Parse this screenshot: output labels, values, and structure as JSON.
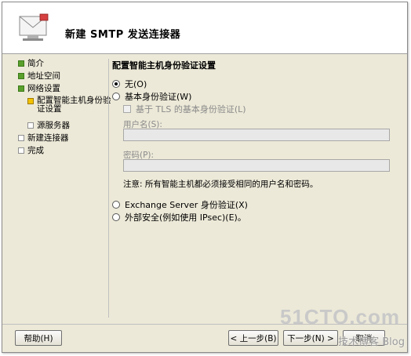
{
  "header": {
    "title": "新建 SMTP 发送连接器",
    "icon": "mail-server-icon"
  },
  "nav": {
    "items": [
      {
        "label": "简介",
        "status": "done"
      },
      {
        "label": "地址空间",
        "status": "done"
      },
      {
        "label": "网络设置",
        "status": "done"
      },
      {
        "label": "配置智能主机身份验证设置",
        "status": "current"
      },
      {
        "label": "源服务器",
        "status": "todo"
      },
      {
        "label": "新建连接器",
        "status": "todo"
      },
      {
        "label": "完成",
        "status": "todo"
      }
    ]
  },
  "content": {
    "section_title": "配置智能主机身份验证设置",
    "options": [
      {
        "label": "无(O)",
        "checked": true
      },
      {
        "label": "基本身份验证(W)",
        "checked": false
      },
      {
        "label": "Exchange Server 身份验证(X)",
        "checked": false
      },
      {
        "label": "外部安全(例如使用 IPsec)(E)。",
        "checked": false
      }
    ],
    "tls_checkbox": "基于 TLS 的基本身份验证(L)",
    "username_label": "用户名(S):",
    "username_value": "",
    "password_label": "密码(P):",
    "password_value": "",
    "note": "注意: 所有智能主机都必须接受相同的用户名和密码。"
  },
  "buttons": {
    "help": "帮助(H)",
    "back": "< 上一步(B)",
    "next": "下一步(N) >",
    "cancel": "取消"
  },
  "watermark": {
    "site": "51CTO.com",
    "blog": "技术博客 Blog"
  }
}
